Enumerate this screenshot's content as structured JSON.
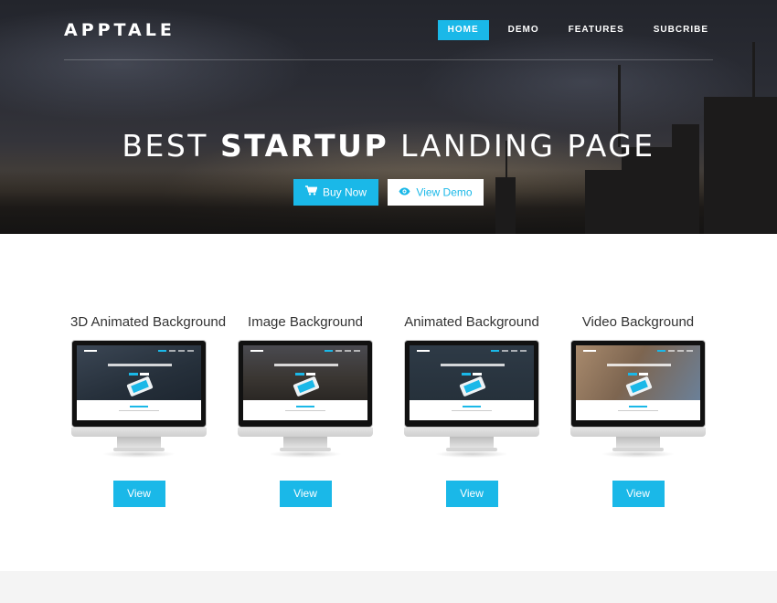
{
  "colors": {
    "accent": "#1ab8e8",
    "hero_dark": "#2a2c34",
    "footer_bg": "#f4f4f4"
  },
  "header": {
    "logo": "APPTALE",
    "nav": [
      {
        "label": "HOME",
        "active": true
      },
      {
        "label": "DEMO",
        "active": false
      },
      {
        "label": "FEATURES",
        "active": false
      },
      {
        "label": "SUBCRIBE",
        "active": false
      }
    ]
  },
  "hero": {
    "headline_pre": "BEST ",
    "headline_bold": "STARTUP",
    "headline_post": " LANDING PAGE",
    "buy_button": {
      "label": "Buy Now",
      "icon": "shopping-cart-icon"
    },
    "demo_button": {
      "label": "View Demo",
      "icon": "eye-icon"
    }
  },
  "demos": [
    {
      "title": "3D Animated Background",
      "button": "View"
    },
    {
      "title": "Image Background",
      "button": "View"
    },
    {
      "title": "Animated Background",
      "button": "View"
    },
    {
      "title": "Video Background",
      "button": "View"
    }
  ]
}
